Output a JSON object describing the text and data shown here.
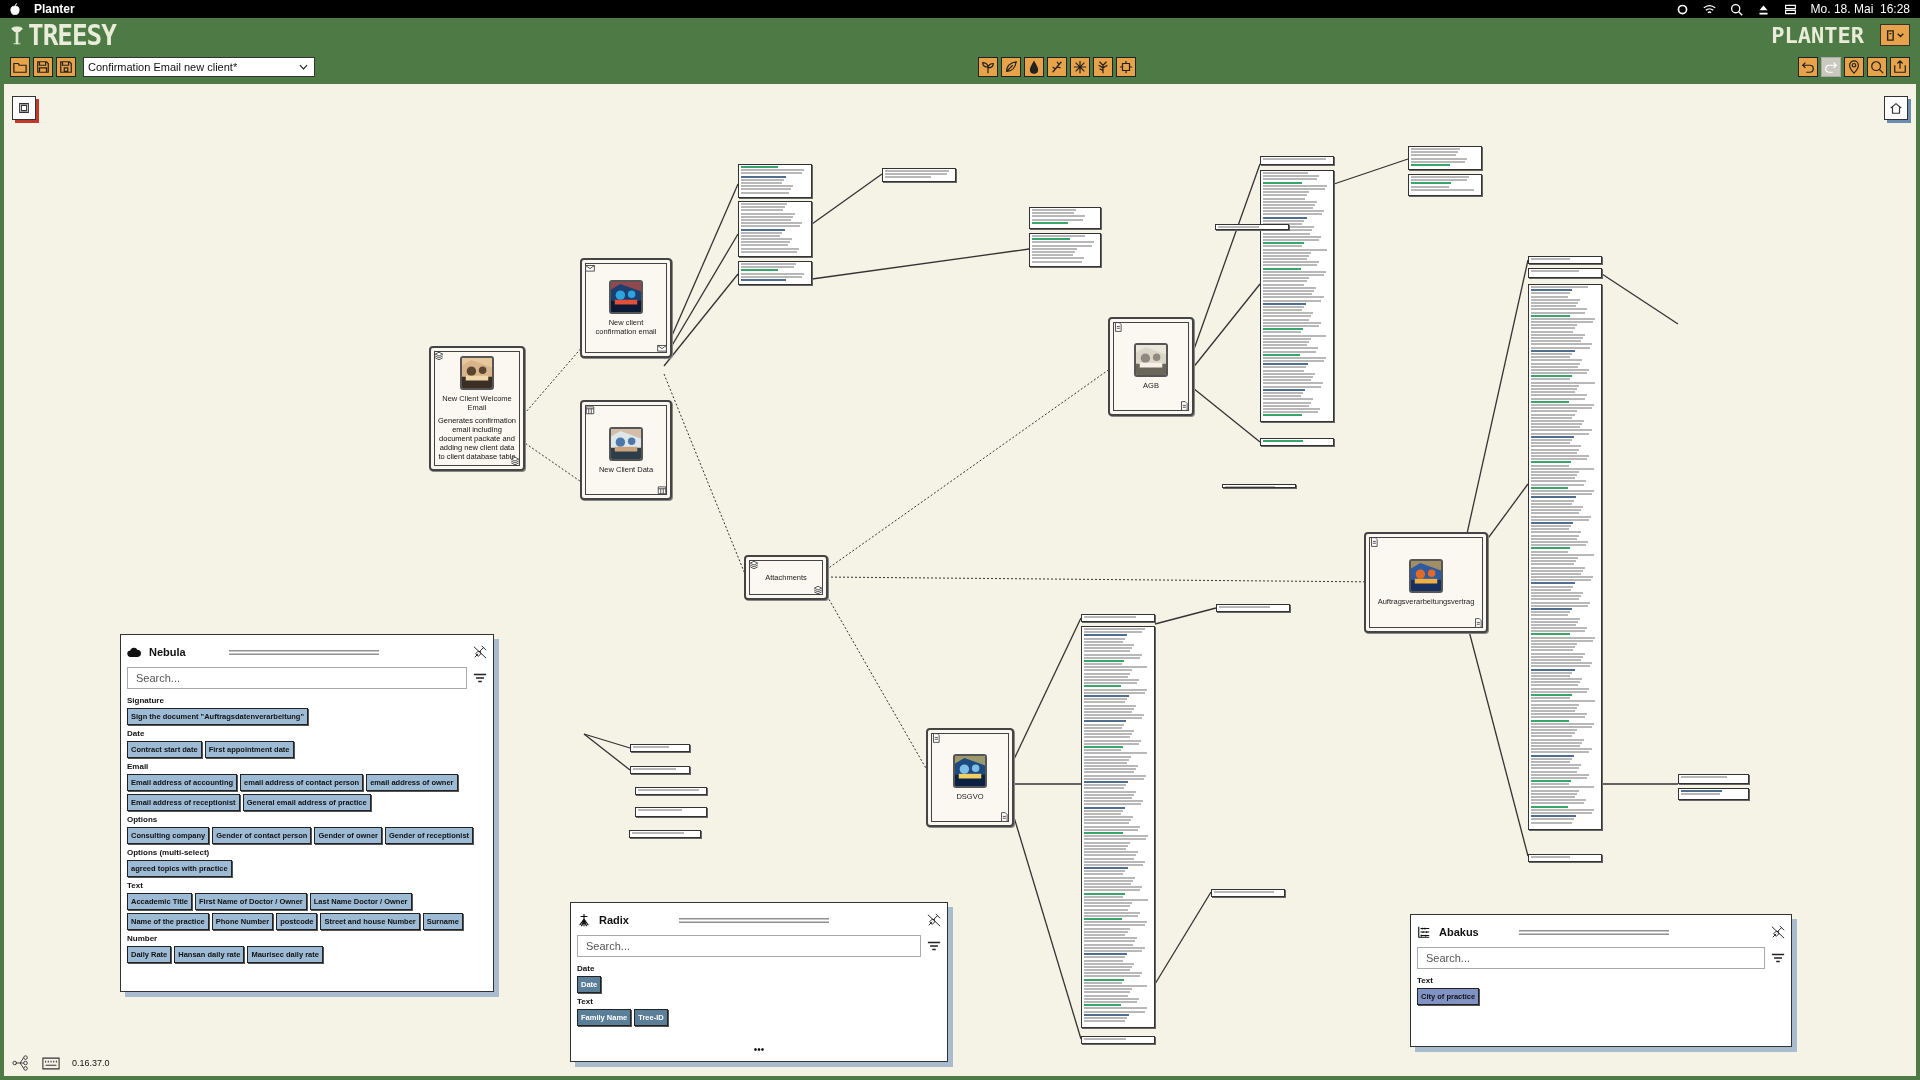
{
  "menubar": {
    "app": "Planter",
    "clock": "Mo. 18. Mai  16:28"
  },
  "header": {
    "logo": "TREESY",
    "product": "PLANTER"
  },
  "toolbar": {
    "document": "Confirmation Email new client*",
    "left_tools": [
      {
        "kind": "folder",
        "disabled": false
      },
      {
        "kind": "save",
        "disabled": false
      },
      {
        "kind": "save-as",
        "disabled": false
      }
    ],
    "plant_tools": [
      {
        "kind": "seedling",
        "disabled": false
      },
      {
        "kind": "leaf",
        "disabled": false
      },
      {
        "kind": "drop",
        "disabled": false
      },
      {
        "kind": "branch",
        "disabled": false
      },
      {
        "kind": "snowflake",
        "disabled": false
      },
      {
        "kind": "tree",
        "disabled": false
      },
      {
        "kind": "cross",
        "disabled": false
      }
    ],
    "right_tools": [
      {
        "kind": "undo",
        "disabled": false
      },
      {
        "kind": "redo",
        "disabled": true
      },
      {
        "kind": "pin",
        "disabled": false
      },
      {
        "kind": "search",
        "disabled": false
      },
      {
        "kind": "export",
        "disabled": false
      }
    ]
  },
  "nodes": [
    {
      "kind": "layers",
      "label": "New Client Welcome Email",
      "description": "Generates confirmation email including document packate and adding new client data to client database table",
      "has_image": true
    },
    {
      "kind": "email",
      "label": "New client confirmation email",
      "has_image": true
    },
    {
      "kind": "table",
      "label": "New Client Data",
      "has_image": true
    },
    {
      "kind": "layers",
      "label": "Attachments",
      "has_image": false
    },
    {
      "kind": "document",
      "label": "AGB",
      "has_image": true
    },
    {
      "kind": "document",
      "label": "Auftragsverarbeitungsvertrag",
      "has_image": true
    },
    {
      "kind": "document",
      "label": "DSGVO",
      "has_image": true
    }
  ],
  "panels": [
    {
      "kind": "cloud",
      "title": "Nebula",
      "color": "#9dbbd4",
      "search": {
        "placeholder": "Search..."
      },
      "groups": [
        {
          "heading": "Signature",
          "chips": [
            "Sign the document \"Auftragsdatenverarbeitung\""
          ]
        },
        {
          "heading": "Date",
          "chips": [
            "Contract start date",
            "First appointment date"
          ]
        },
        {
          "heading": "Email",
          "chips": [
            "Email address of accounting",
            "email address of contact person",
            "email address of owner",
            "Email address of receptionist",
            "General email address of practice"
          ]
        },
        {
          "heading": "Options",
          "chips": [
            "Consulting company",
            "Gender of contact person",
            "Gender of owner",
            "Gender of receptionist"
          ]
        },
        {
          "heading": "Options (multi-select)",
          "chips": [
            "agreed topics with practice"
          ]
        },
        {
          "heading": "Text",
          "chips": [
            "Accademic Title",
            "First Name of Doctor / Owner",
            "Last Name Doctor / Owner",
            "Name of the practice",
            "Phone Number",
            "postcode",
            "Street and house Number",
            "Surname"
          ]
        },
        {
          "heading": "Number",
          "chips": [
            "Daily Rate",
            "Hansan daily rate",
            "Maurisec daily rate"
          ]
        }
      ]
    },
    {
      "kind": "roots",
      "title": "Radix",
      "color": "#5c7f99",
      "search": {
        "placeholder": "Search..."
      },
      "groups": [
        {
          "heading": "Date",
          "chips": [
            "Date"
          ]
        },
        {
          "heading": "Text",
          "chips": [
            "Family Name",
            "Tree-ID"
          ]
        }
      ],
      "more": "•••"
    },
    {
      "kind": "abacus",
      "title": "Abakus",
      "color": "#8192c4",
      "search": {
        "placeholder": "Search..."
      },
      "groups": [
        {
          "heading": "Text",
          "chips": [
            "City of practice"
          ]
        }
      ]
    }
  ],
  "version": "0.16.37.0"
}
